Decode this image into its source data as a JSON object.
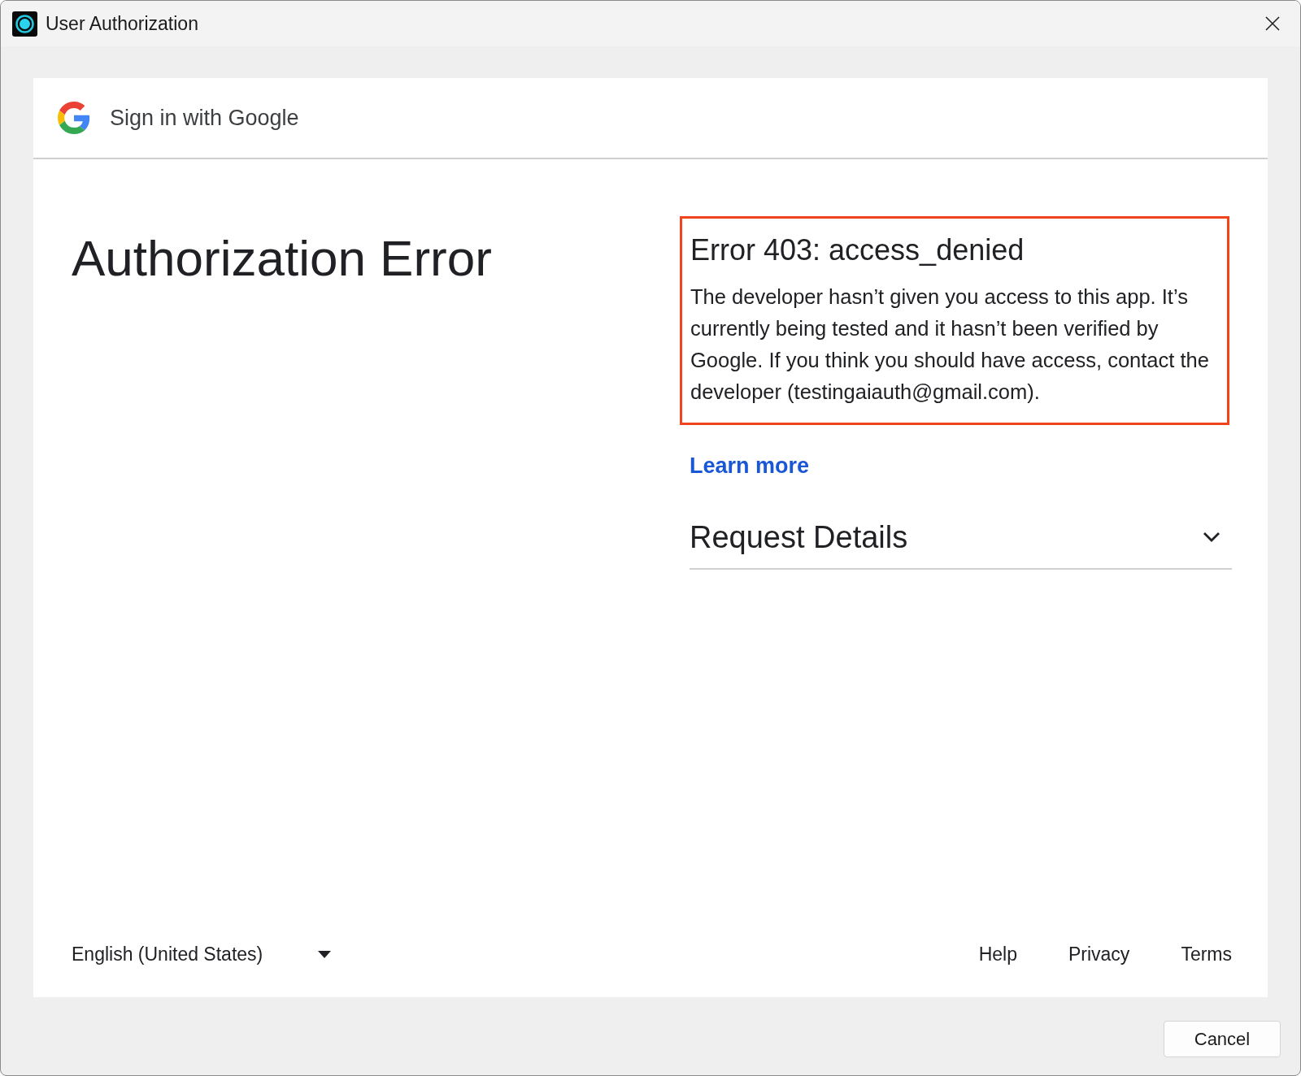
{
  "window": {
    "title": "User Authorization"
  },
  "header": {
    "title": "Sign in with Google"
  },
  "heading": "Authorization Error",
  "error": {
    "title": "Error 403: access_denied",
    "message": "The developer hasn’t given you access to this app. It’s currently being tested and it hasn’t been verified by Google. If you think you should have access, contact the developer (testingaiauth@gmail.com)."
  },
  "learn_more": "Learn more",
  "request_details": {
    "label": "Request Details",
    "expanded": false
  },
  "footer": {
    "language": "English (United States)",
    "links": [
      "Help",
      "Privacy",
      "Terms"
    ]
  },
  "buttons": [
    "Cancel"
  ]
}
